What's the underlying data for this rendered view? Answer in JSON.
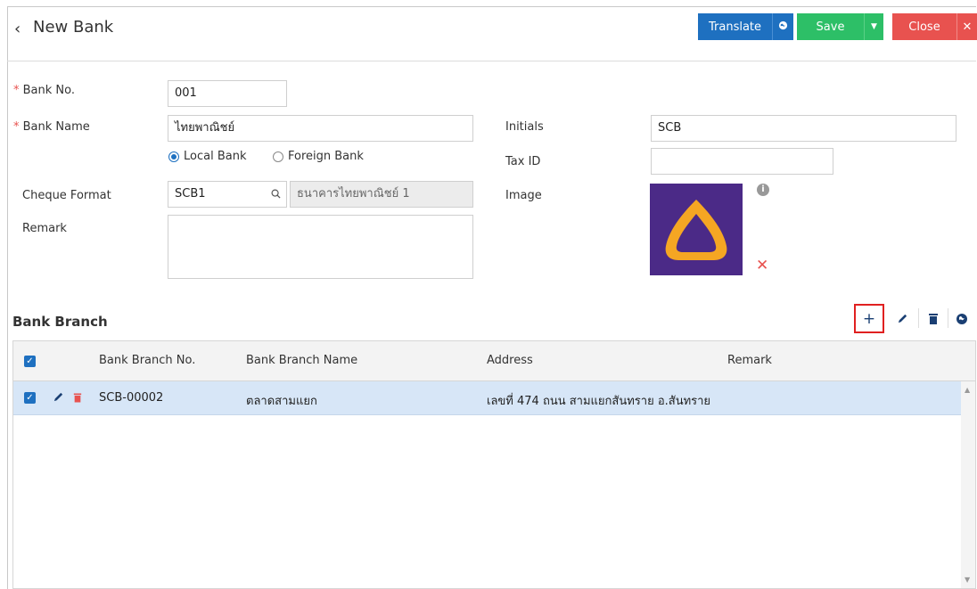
{
  "header": {
    "back_icon": "‹",
    "title": "New Bank",
    "translate_label": "Translate",
    "translate_icon": "globe-icon",
    "save_label": "Save",
    "save_icon": "caret-down-icon",
    "close_label": "Close",
    "close_icon": "close-icon"
  },
  "form": {
    "bank_no_label": "Bank No.",
    "bank_no_value": "001",
    "bank_name_label": "Bank Name",
    "bank_name_value": "ไทยพาณิชย์",
    "local_bank_label": "Local Bank",
    "foreign_bank_label": "Foreign Bank",
    "selected_bank_type": "Local Bank",
    "cheque_format_label": "Cheque Format",
    "cheque_format_value": "SCB1",
    "cheque_format_name": "ธนาคารไทยพาณิชย์ 1",
    "remark_label": "Remark",
    "remark_value": "",
    "initials_label": "Initials",
    "initials_value": "SCB",
    "tax_id_label": "Tax ID",
    "tax_id_value": "",
    "image_label": "Image",
    "required_mark": "*",
    "logo_colors": {
      "background": "#4b2a87",
      "emblem": "#f5a623"
    }
  },
  "branch_section": {
    "title": "Bank Branch",
    "toolbar": [
      "add-icon",
      "edit-icon",
      "delete-icon",
      "translate-icon"
    ],
    "columns": [
      "Bank Branch No.",
      "Bank Branch Name",
      "Address",
      "Remark"
    ],
    "rows": [
      {
        "no": "SCB-00002",
        "name": "ตลาดสามแยก",
        "address": "เลขที่ 474 ถนน สามแยกสันทราย อ.สันทราย",
        "remark": "",
        "checked": true
      }
    ]
  },
  "colors": {
    "accent_blue": "#1e70c0",
    "save_green": "#2dbf67",
    "close_red": "#e8524f",
    "selected_row": "#d7e6f7"
  }
}
